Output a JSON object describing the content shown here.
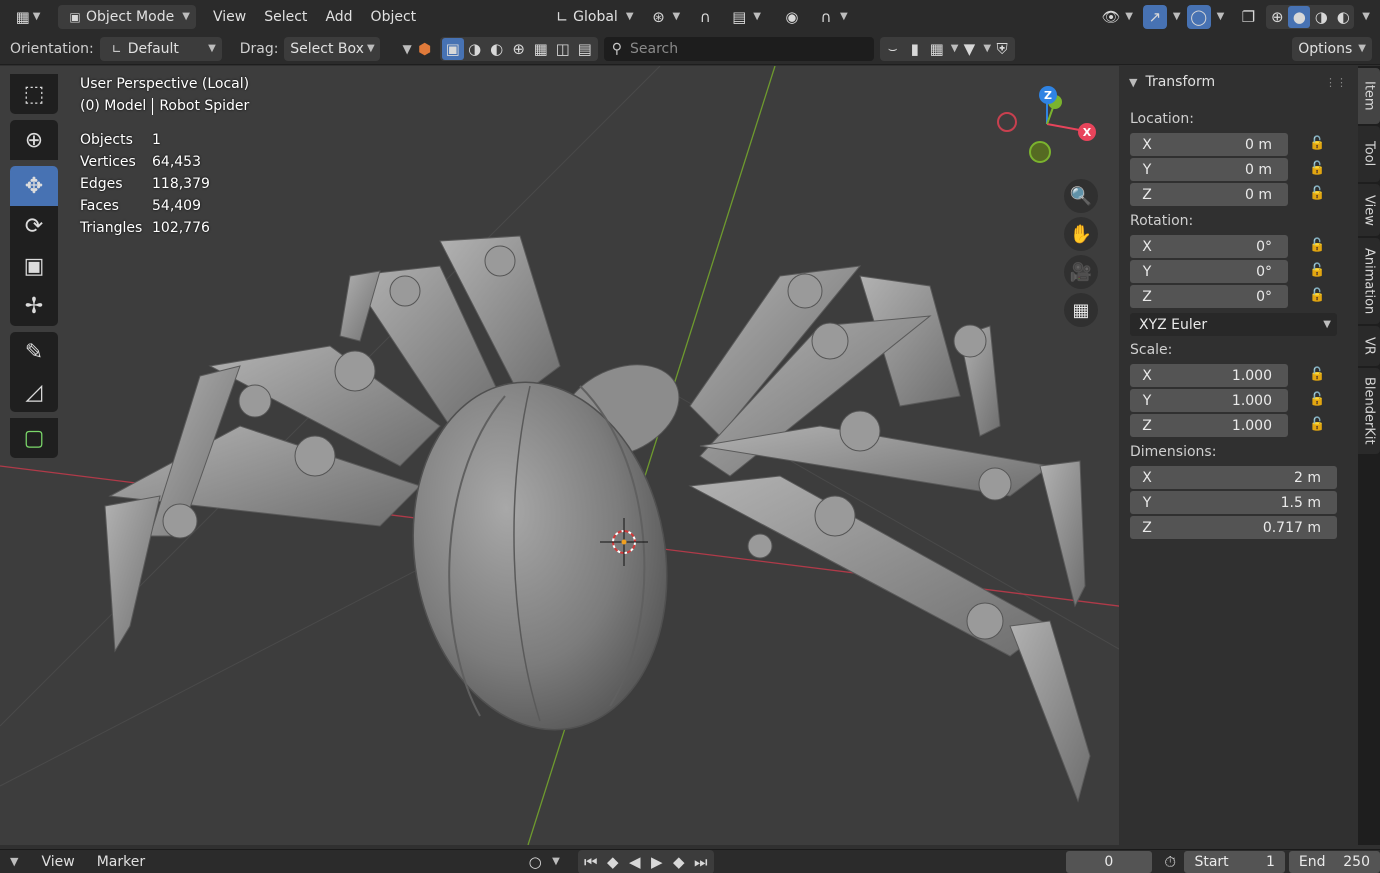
{
  "header": {
    "mode": "Object Mode",
    "menus": [
      "View",
      "Select",
      "Add",
      "Object"
    ],
    "transform_orientation": "Global"
  },
  "toolheader": {
    "orientation_label": "Orientation:",
    "orientation_value": "Default",
    "drag_label": "Drag:",
    "drag_value": "Select Box",
    "search_placeholder": "Search",
    "options_label": "Options"
  },
  "viewport": {
    "view_name": "User Perspective (Local)",
    "collection": "(0) Model",
    "object_name": "Robot Spider",
    "stats": [
      {
        "label": "Objects",
        "value": "1"
      },
      {
        "label": "Vertices",
        "value": "64,453"
      },
      {
        "label": "Edges",
        "value": "118,379"
      },
      {
        "label": "Faces",
        "value": "54,409"
      },
      {
        "label": "Triangles",
        "value": "102,776"
      }
    ],
    "gizmo": {
      "x": "X",
      "z": "Z"
    }
  },
  "npanel": {
    "title": "Transform",
    "location_label": "Location:",
    "location": [
      {
        "axis": "X",
        "value": "0 m"
      },
      {
        "axis": "Y",
        "value": "0 m"
      },
      {
        "axis": "Z",
        "value": "0 m"
      }
    ],
    "rotation_label": "Rotation:",
    "rotation": [
      {
        "axis": "X",
        "value": "0°"
      },
      {
        "axis": "Y",
        "value": "0°"
      },
      {
        "axis": "Z",
        "value": "0°"
      }
    ],
    "rotation_mode": "XYZ Euler",
    "scale_label": "Scale:",
    "scale": [
      {
        "axis": "X",
        "value": "1.000"
      },
      {
        "axis": "Y",
        "value": "1.000"
      },
      {
        "axis": "Z",
        "value": "1.000"
      }
    ],
    "dimensions_label": "Dimensions:",
    "dimensions": [
      {
        "axis": "X",
        "value": "2 m"
      },
      {
        "axis": "Y",
        "value": "1.5 m"
      },
      {
        "axis": "Z",
        "value": "0.717 m"
      }
    ]
  },
  "sidetabs": [
    "Item",
    "Tool",
    "View",
    "Animation",
    "VR",
    "BlenderKit"
  ],
  "timeline": {
    "view_label": "View",
    "marker_label": "Marker",
    "current_frame": "0",
    "start_label": "Start",
    "start_value": "1",
    "end_label": "End",
    "end_value": "250"
  },
  "colors": {
    "accent": "#4772b3",
    "x_axis": "#e8445b",
    "y_axis": "#7bb32e",
    "z_axis": "#2f83e3"
  }
}
